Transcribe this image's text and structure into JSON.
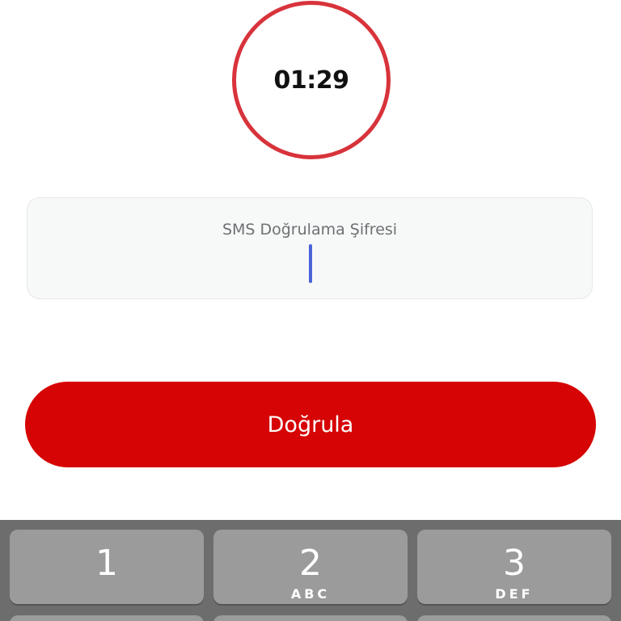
{
  "timer": {
    "value": "01:29"
  },
  "otp": {
    "label": "SMS Doğrulama Şifresi",
    "value": ""
  },
  "verify_button": {
    "label": "Doğrula"
  },
  "keyboard": {
    "keys": [
      {
        "digit": "1",
        "letters": ""
      },
      {
        "digit": "2",
        "letters": "ABC"
      },
      {
        "digit": "3",
        "letters": "DEF"
      }
    ]
  },
  "colors": {
    "accent_red": "#d60404",
    "timer_ring": "#d8333b",
    "caret_blue": "#4a64d8",
    "keyboard_bg": "#6d6d6d",
    "key_bg": "#9b9b9b"
  }
}
